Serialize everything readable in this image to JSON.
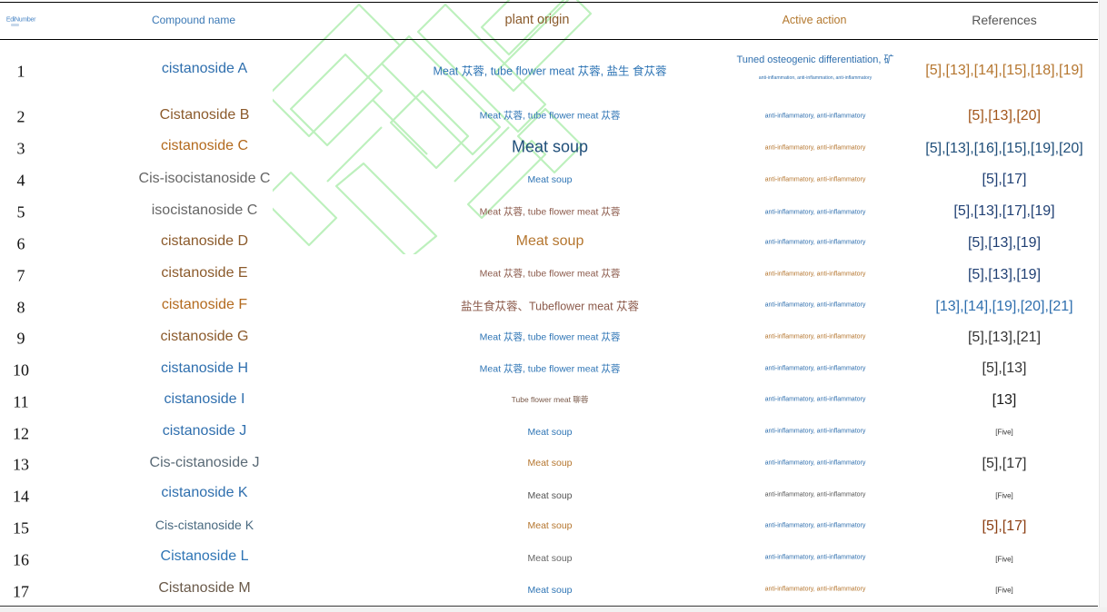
{
  "colors": {
    "blue": "#2f6fae",
    "brown": "#8b5a2b",
    "darkblue": "#1f4e79",
    "gray": "#666666",
    "orange": "#b5762f",
    "ink": "#333333"
  },
  "table": {
    "headers": {
      "number": "EdiNumber",
      "name": "Compound name",
      "plant": "plant origin",
      "action": "Active action",
      "references": "References"
    },
    "rows": [
      {
        "n": "1",
        "name": "cistanoside A",
        "plant": "Meat 苁蓉, tube flower meat 苁蓉, 盐生 食苁蓉",
        "action": "Tuned osteogenic differentiation, 矿",
        "action_sub": "anti-inflammation, anti-inflammation, anti-inflammatory",
        "refs": "[5],[13],[14],[15],[18],[19]"
      },
      {
        "n": "2",
        "name": "Cistanoside B",
        "plant": "Meat 苁蓉, tube flower meat 苁蓉",
        "action": "anti-inflammatory, anti-inflammatory",
        "refs": "[5],[13],[20]"
      },
      {
        "n": "3",
        "name": "cistanoside C",
        "plant": "Meat soup",
        "action": "anti-inflammatory, anti-inflammatory",
        "refs": "[5],[13],[16],[15],[19],[20]"
      },
      {
        "n": "4",
        "name": "Cis-isocistanoside C",
        "plant": "Meat soup",
        "action": "anti-inflammatory, anti-inflammatory",
        "refs": "[5],[17]"
      },
      {
        "n": "5",
        "name": "isocistanoside C",
        "plant": "Meat 苁蓉, tube flower meat 苁蓉",
        "action": "anti-inflammatory, anti-inflammatory",
        "refs": "[5],[13],[17],[19]"
      },
      {
        "n": "6",
        "name": "cistanoside D",
        "plant": "Meat soup",
        "action": "anti-inflammatory, anti-inflammatory",
        "refs": "[5],[13],[19]"
      },
      {
        "n": "7",
        "name": "cistanoside E",
        "plant": "Meat 苁蓉, tube flower meat 苁蓉",
        "action": "anti-inflammatory, anti-inflammatory",
        "refs": "[5],[13],[19]"
      },
      {
        "n": "8",
        "name": "cistanoside F",
        "plant": "盐生食苁蓉、Tubeflower meat 苁蓉",
        "action": "anti-inflammatory, anti-inflammatory",
        "refs": "[13],[14],[19],[20],[21]"
      },
      {
        "n": "9",
        "name": "cistanoside G",
        "plant": "Meat 苁蓉, tube flower meat 苁蓉",
        "action": "anti-inflammatory, anti-inflammatory",
        "refs": "[5],[13],[21]"
      },
      {
        "n": "10",
        "name": "cistanoside H",
        "plant": "Meat 苁蓉, tube flower meat 苁蓉",
        "action": "anti-inflammatory, anti-inflammatory",
        "refs": "[5],[13]"
      },
      {
        "n": "11",
        "name": "cistanoside I",
        "plant": "Tube flower meat 聊蓉",
        "action": "anti-inflammatory, anti-inflammatory",
        "refs": "[13]"
      },
      {
        "n": "12",
        "name": "cistanoside J",
        "plant": "Meat soup",
        "action": "anti-inflammatory, anti-inflammatory",
        "refs": "[Five]"
      },
      {
        "n": "13",
        "name": "Cis-cistanoside J",
        "plant": "Meat soup",
        "action": "anti-inflammatory, anti-inflammatory",
        "refs": "[5],[17]"
      },
      {
        "n": "14",
        "name": "cistanoside K",
        "plant": "Meat soup",
        "action": "anti-inflammatory, anti-inflammatory",
        "refs": "[Five]"
      },
      {
        "n": "15",
        "name": "Cis-cistanoside K",
        "plant": "Meat soup",
        "action": "anti-inflammatory, anti-inflammatory",
        "refs": "[5],[17]"
      },
      {
        "n": "16",
        "name": "Cistanoside L",
        "plant": "Meat soup",
        "action": "anti-inflammatory, anti-inflammatory",
        "refs": "[Five]"
      },
      {
        "n": "17",
        "name": "Cistanoside M",
        "plant": "Meat soup",
        "action": "anti-inflammatory, anti-inflammatory",
        "refs": "[Five]"
      }
    ]
  }
}
